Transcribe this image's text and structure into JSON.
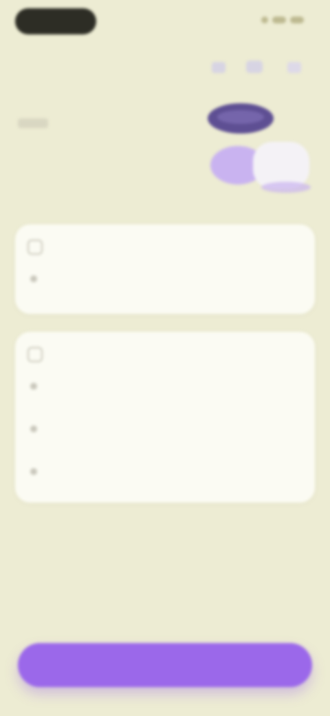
{
  "header": {
    "left_pill_label": "",
    "right_action_label": ""
  },
  "hero": {
    "title": ""
  },
  "card_one": {
    "title": "",
    "text": ""
  },
  "card_two": {
    "title": "",
    "items": [
      {
        "text": ""
      },
      {
        "text": ""
      },
      {
        "text": ""
      }
    ]
  },
  "cta": {
    "label": ""
  },
  "colors": {
    "background": "#edecd3",
    "card": "#fbfbf3",
    "accent": "#9b68ea",
    "dark": "#2d2d25"
  },
  "icons": {
    "card_one": "note-icon",
    "card_two": "list-icon"
  }
}
